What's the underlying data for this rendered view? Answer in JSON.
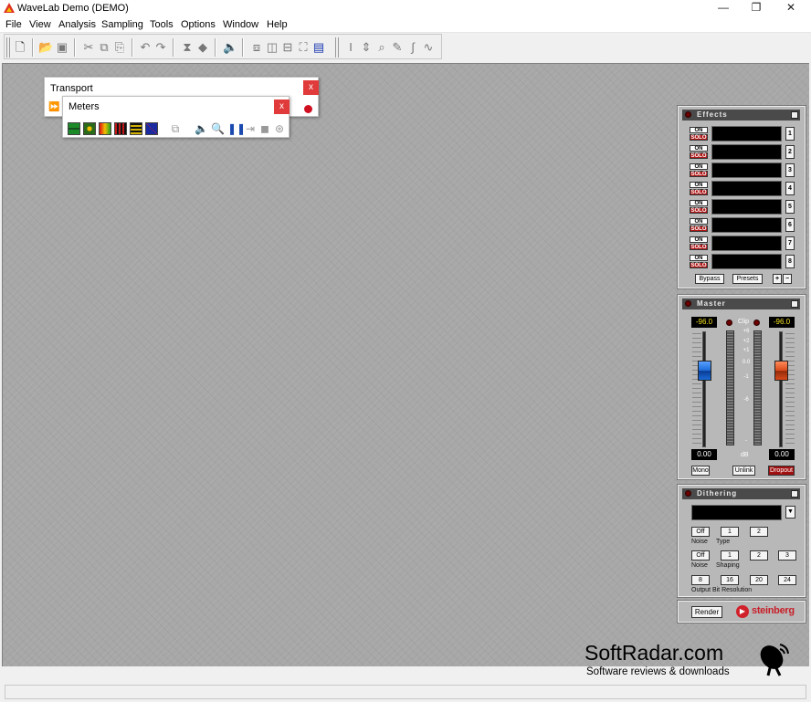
{
  "window": {
    "title": "WaveLab Demo (DEMO)",
    "minimize": "—",
    "maximize": "❐",
    "close": "✕"
  },
  "menu": [
    "File",
    "View",
    "Analysis",
    "Sampling",
    "Tools",
    "Options",
    "Window",
    "Help"
  ],
  "transport": {
    "title": "Transport",
    "close": "x"
  },
  "meters": {
    "title": "Meters",
    "close": "x"
  },
  "effects": {
    "title": "Effects",
    "on_label": "ON",
    "solo_label": "SOLO",
    "slots": [
      "1",
      "2",
      "3",
      "4",
      "5",
      "6",
      "7",
      "8"
    ],
    "bypass": "Bypass",
    "presets": "Presets",
    "plus": "+",
    "minus": "−"
  },
  "master": {
    "title": "Master",
    "left_peak": "-96.0",
    "right_peak": "-96.0",
    "clip_label": "Clip",
    "scale": [
      "+6",
      "+2",
      "+1",
      "0.0",
      "-1",
      "-6",
      "-"
    ],
    "left_value": "0.00",
    "right_value": "0.00",
    "db_label": "dB",
    "mono": "Mono",
    "unlink": "Unlink",
    "dropout": "Dropout"
  },
  "dithering": {
    "title": "Dithering",
    "dropdown_arrow": "▼",
    "noise_type_buttons": [
      "Off",
      "1",
      "2"
    ],
    "noise_type_label1": "Noise",
    "noise_type_label2": "Type",
    "shaping_buttons": [
      "Off",
      "1",
      "2",
      "3"
    ],
    "shaping_label1": "Noise",
    "shaping_label2": "Shaping",
    "bit_buttons": [
      "8",
      "16",
      "20",
      "24"
    ],
    "bit_label": "Output Bit Resolution"
  },
  "render": {
    "label": "Render",
    "brand": "steinberg"
  },
  "watermark": {
    "title": "SoftRadar.com",
    "subtitle": "Software reviews & downloads"
  },
  "colors": {
    "workspace": "#a7a7a7",
    "panel": "#b8b8b8",
    "lcd_text": "#f0e020",
    "solo_red": "#b01818",
    "fader_left": "#1a6ad8",
    "fader_right": "#d84a1a"
  }
}
